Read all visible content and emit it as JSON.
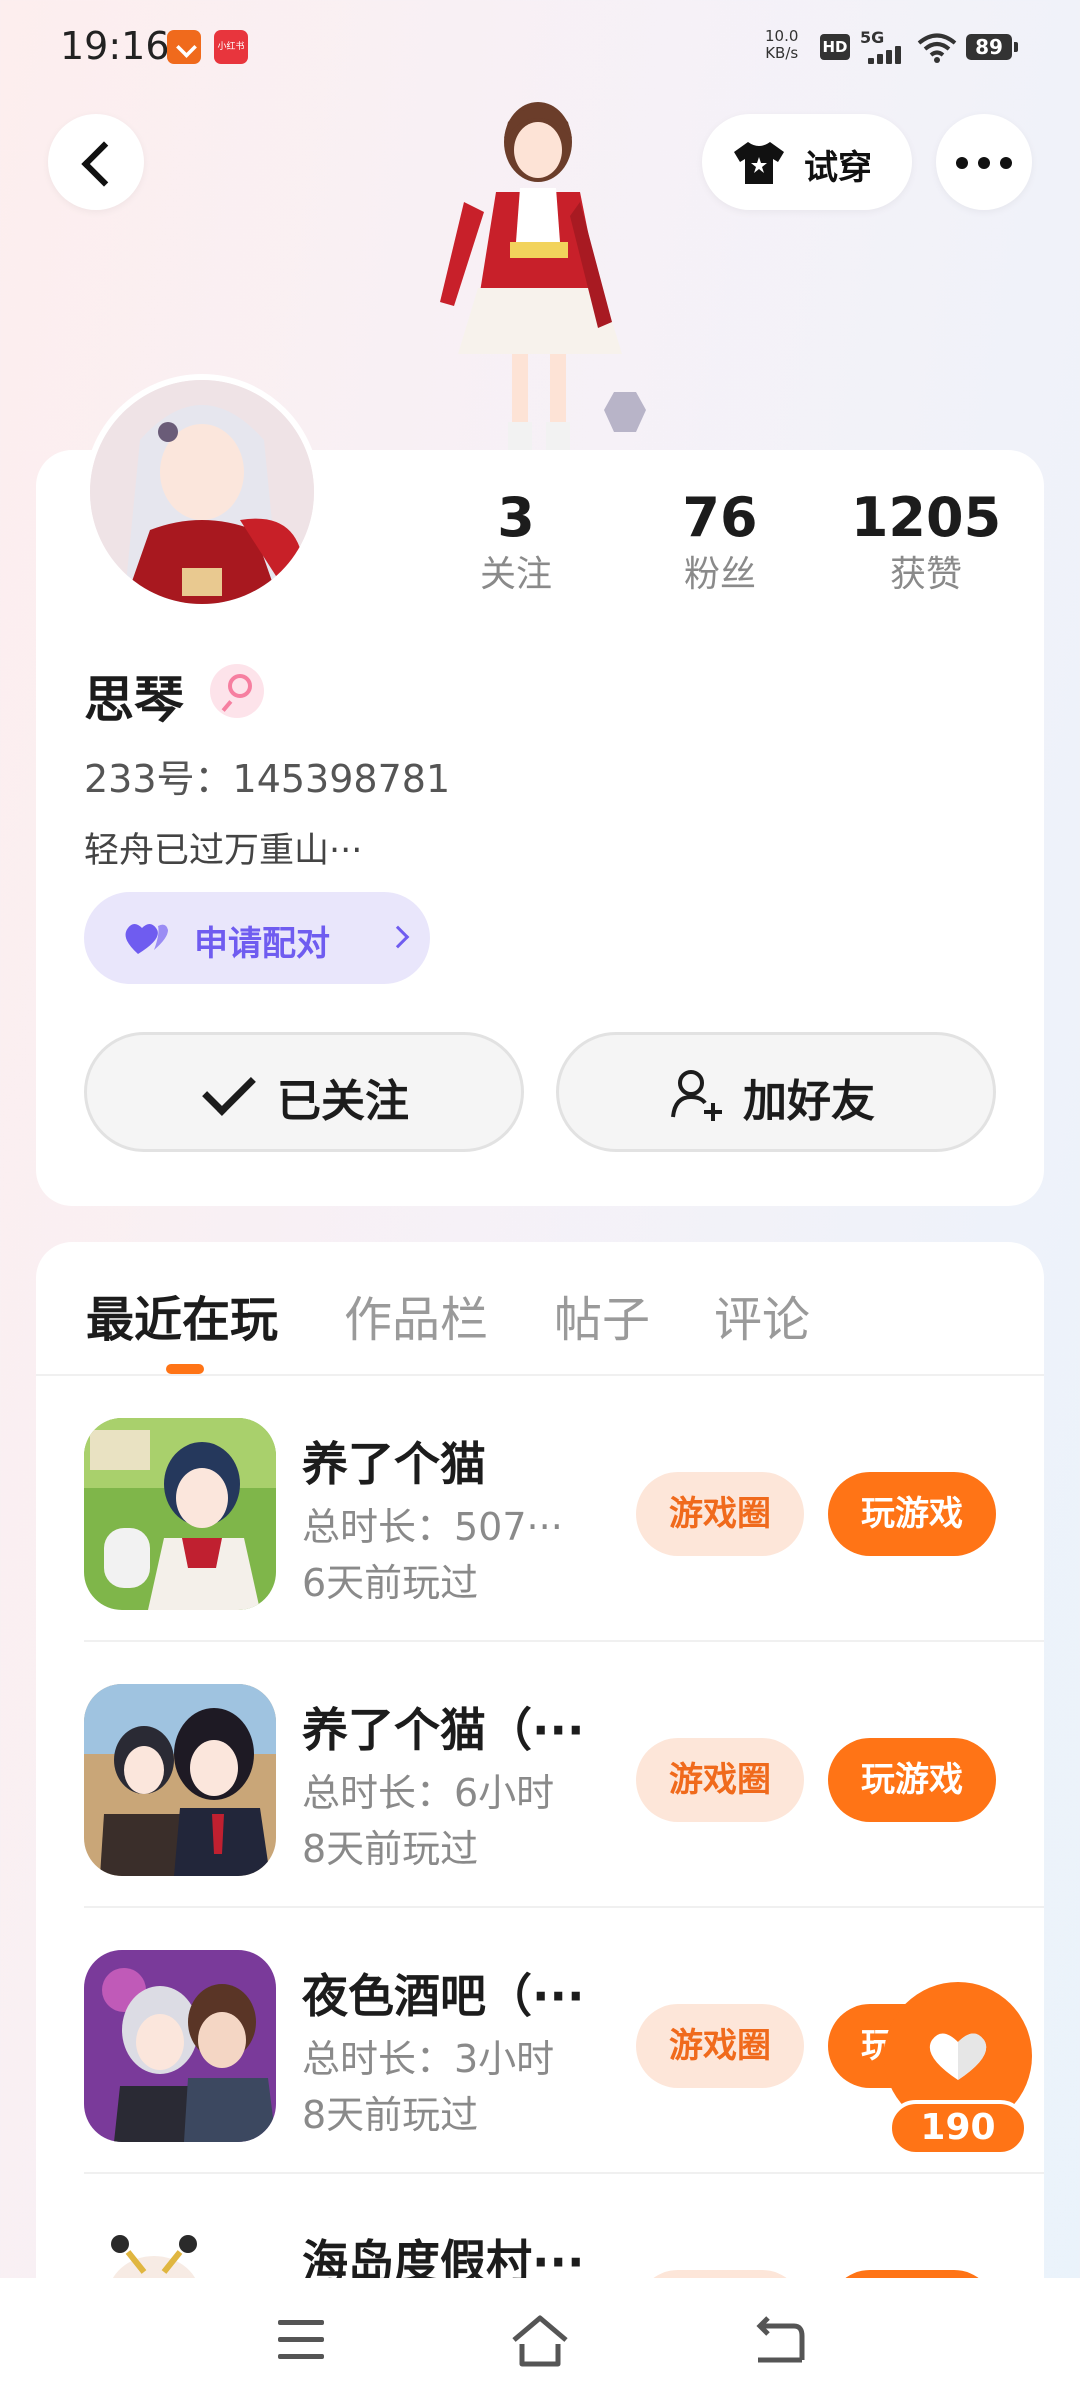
{
  "status_bar": {
    "time": "19:16",
    "app_badge": "小红书",
    "net_speed_value": "10.0",
    "net_speed_unit": "KB/s",
    "hd": "HD",
    "network": "5G",
    "battery": "89"
  },
  "header": {
    "tryon_label": "试穿"
  },
  "profile": {
    "stats": [
      {
        "value": "3",
        "label": "关注"
      },
      {
        "value": "76",
        "label": "粉丝"
      },
      {
        "value": "1205",
        "label": "获赞"
      }
    ],
    "name": "思琴",
    "uid": "233号：145398781",
    "bio": "轻舟已过万重山···",
    "pair_label": "申请配对",
    "follow_label": "已关注",
    "add_friend_label": "加好友"
  },
  "tabs": [
    {
      "label": "最近在玩",
      "active": true
    },
    {
      "label": "作品栏",
      "active": false
    },
    {
      "label": "帖子",
      "active": false
    },
    {
      "label": "评论",
      "active": false
    }
  ],
  "games": [
    {
      "name": "养了个猫",
      "duration": "总时长：507···",
      "last_played": "6天前玩过",
      "circle_label": "游戏圈",
      "play_label": "玩游戏"
    },
    {
      "name": "养了个猫（···",
      "duration": "总时长：6小时",
      "last_played": "8天前玩过",
      "circle_label": "游戏圈",
      "play_label": "玩游戏"
    },
    {
      "name": "夜色酒吧（···",
      "duration": "总时长：3小时",
      "last_played": "8天前玩过",
      "circle_label": "游戏圈",
      "play_label": "玩游戏"
    },
    {
      "name": "海岛度假村···",
      "duration": "",
      "last_played": "",
      "circle_label": "",
      "play_label": ""
    }
  ],
  "like": {
    "count": "190"
  },
  "colors": {
    "accent": "#ff7416",
    "pair_purple": "#6f5cf0",
    "female_pink": "#f67fa0"
  }
}
